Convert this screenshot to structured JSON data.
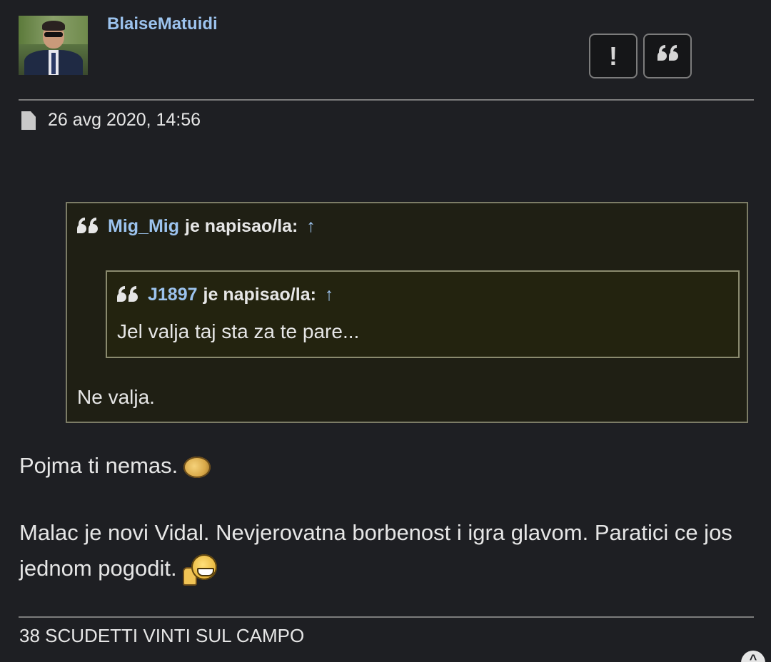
{
  "post": {
    "username": "BlaiseMatuidi",
    "date": "26 avg 2020, 14:56",
    "report_button_label": "!",
    "quote_button_icon": "quote-icon",
    "file_icon": "file-icon"
  },
  "quotes": {
    "outer": {
      "user": "Mig_Mig",
      "wrote": "je napisao/la:",
      "arrow": "↑",
      "text": "Ne valja."
    },
    "inner": {
      "user": "J1897",
      "wrote": "je napisao/la:",
      "arrow": "↑",
      "text": "Jel valja taj sta za te pare..."
    }
  },
  "body": {
    "paragraph1": "Pojma ti nemas.",
    "paragraph2": "Malac je novi Vidal. Nevjerovatna borbenost i igra glavom. Paratici ce jos jednom pogodit.",
    "emoji1": "handshake-emoji",
    "emoji2": "thumbs-up-emoji"
  },
  "signature": "38 SCUDETTI VINTI SUL CAMPO",
  "scroll_top_icon": "chevron-up-icon",
  "colors": {
    "background": "#1e1f23",
    "username": "#9cc3ee",
    "quote_background": "#1f1f14",
    "quote_border": "#7c7c66",
    "text": "#e6e6e6"
  }
}
